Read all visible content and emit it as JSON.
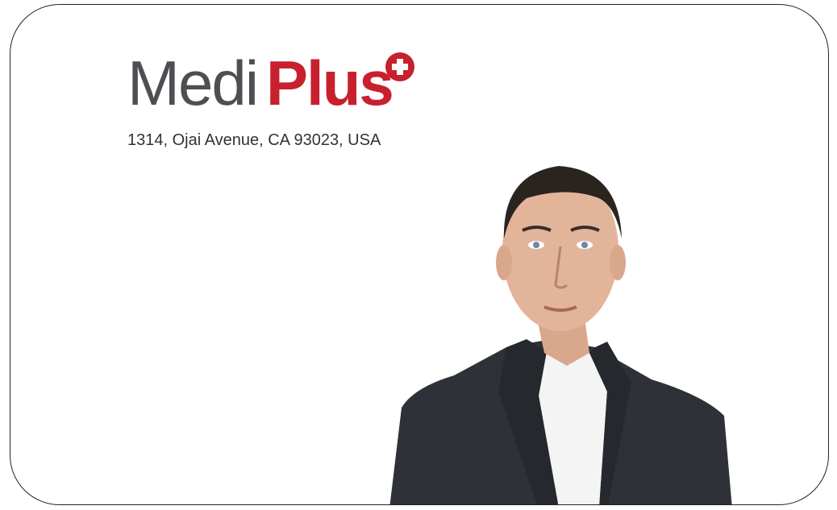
{
  "brand": {
    "name_part1": "Medi",
    "name_part2": "Plus",
    "accent_color": "#c8202e",
    "text_color": "#4d4f52",
    "icon": "medical-cross-icon"
  },
  "address": "1314, Ojai Avenue, CA 93023, USA",
  "photo": {
    "subject": "portrait-photo"
  }
}
